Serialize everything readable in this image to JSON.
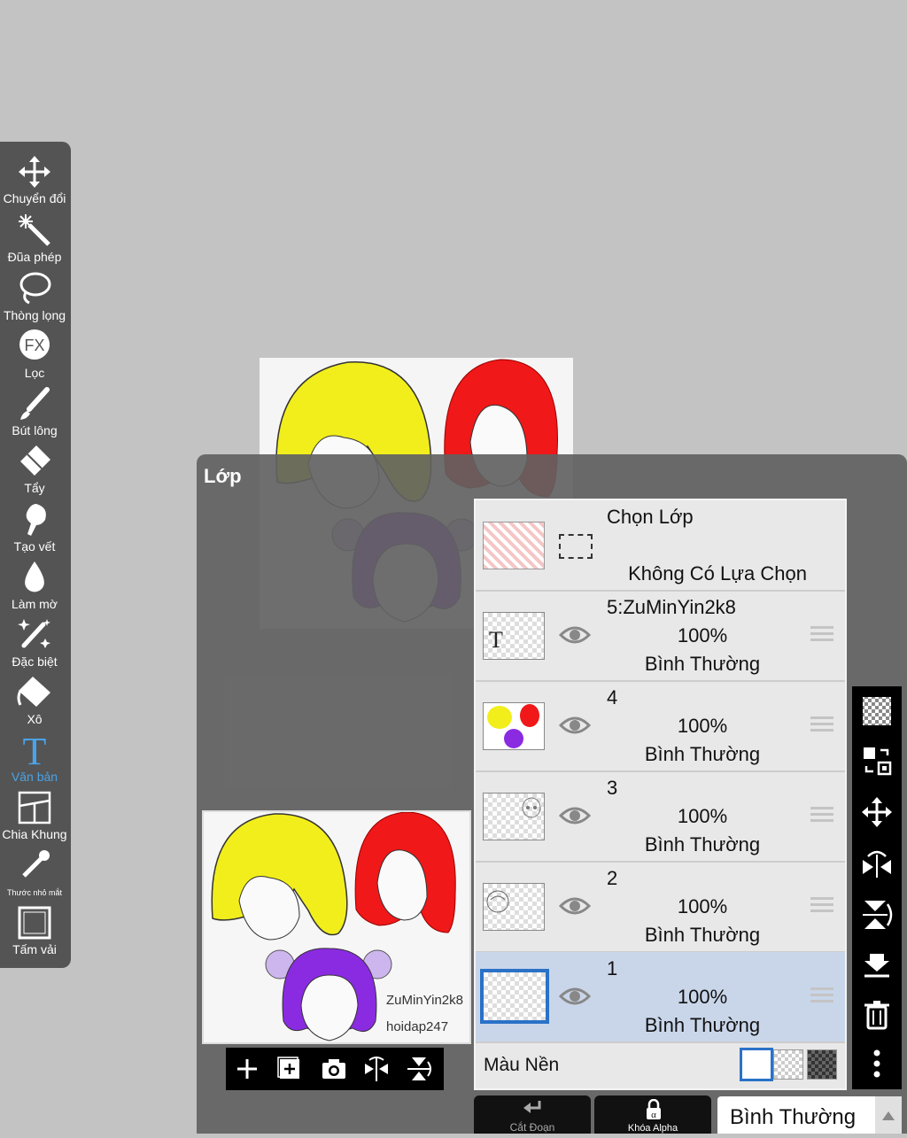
{
  "toolbar": {
    "tools": [
      {
        "label": "Chuyển đổi",
        "icon": "move-icon"
      },
      {
        "label": "Đũa phép",
        "icon": "magic-wand-icon"
      },
      {
        "label": "Thòng lọng",
        "icon": "lasso-icon"
      },
      {
        "label": "Lọc",
        "icon": "fx-filter-icon"
      },
      {
        "label": "Bút lông",
        "icon": "brush-icon"
      },
      {
        "label": "Tẩy",
        "icon": "eraser-icon"
      },
      {
        "label": "Tạo vết",
        "icon": "smudge-icon"
      },
      {
        "label": "Làm mờ",
        "icon": "blur-drop-icon"
      },
      {
        "label": "Đặc biệt",
        "icon": "special-wand-icon"
      },
      {
        "label": "Xô",
        "icon": "bucket-icon"
      },
      {
        "label": "Văn bản",
        "icon": "text-icon",
        "active": true
      },
      {
        "label": "Chia Khung",
        "icon": "frame-divider-icon"
      },
      {
        "label": "Thước nhỏ mắt",
        "icon": "eyedropper-icon"
      },
      {
        "label": "Tấm vải",
        "icon": "canvas-icon"
      }
    ]
  },
  "panel": {
    "title": "Lớp"
  },
  "preview": {
    "watermark_line1": "ZuMinYin2k8",
    "watermark_line2": "hoidap247"
  },
  "selection_row": {
    "title": "Chọn Lớp",
    "status": "Không Có Lựa Chọn"
  },
  "layers": [
    {
      "name": "5:ZuMinYin2k8",
      "opacity": "100%",
      "mode": "Bình Thường"
    },
    {
      "name": "4",
      "opacity": "100%",
      "mode": "Bình Thường"
    },
    {
      "name": "3",
      "opacity": "100%",
      "mode": "Bình Thường"
    },
    {
      "name": "2",
      "opacity": "100%",
      "mode": "Bình Thường"
    },
    {
      "name": "1",
      "opacity": "100%",
      "mode": "Bình Thường",
      "selected": true
    }
  ],
  "background_color": {
    "label": "Màu Nền"
  },
  "bottom_bar": {
    "clip_label": "Cắt Đoạn",
    "alpha_lock_label": "Khóa Alpha",
    "blend_mode": "Bình Thường"
  },
  "colors": {
    "accent": "#2a72c8",
    "active_tool": "#4aa3e8",
    "hair_yellow": "#f2ee1c",
    "hair_red": "#f01818",
    "hair_purple": "#8a2be2"
  }
}
